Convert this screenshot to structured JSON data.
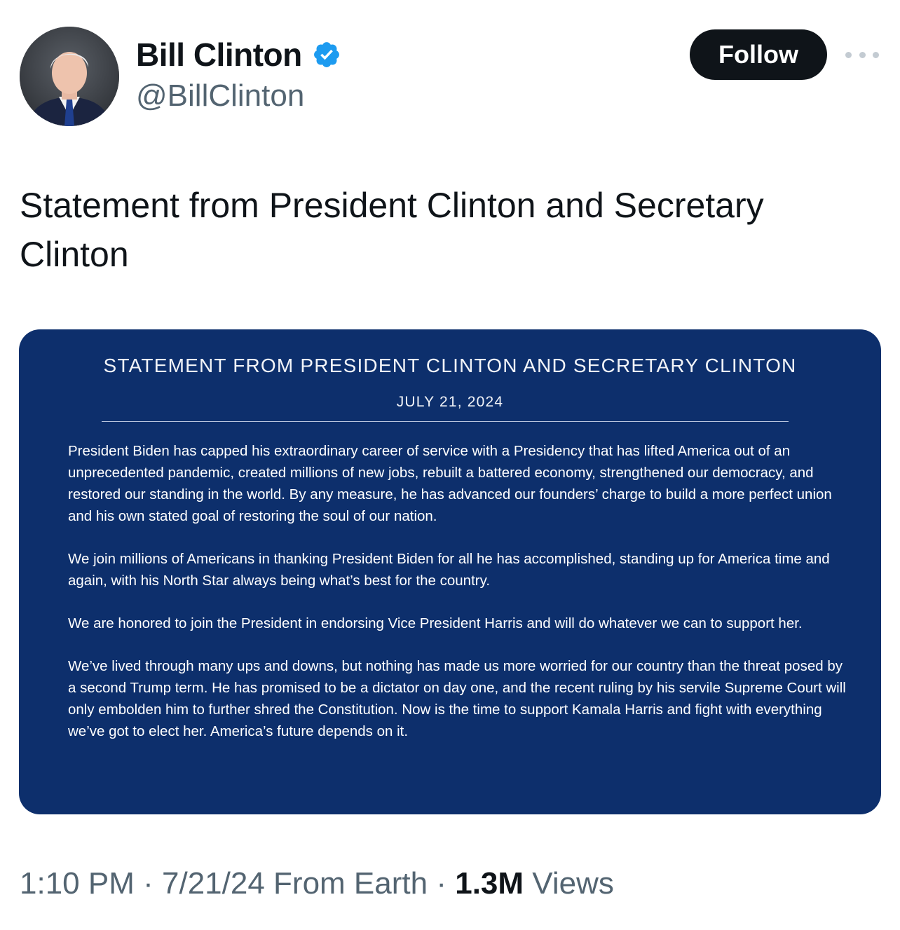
{
  "author": {
    "display_name": "Bill Clinton",
    "handle": "@BillClinton",
    "verified": true,
    "avatar_icon": "profile-photo"
  },
  "actions": {
    "follow_label": "Follow",
    "more_icon": "more-horizontal-icon"
  },
  "tweet": {
    "text": "Statement from President Clinton and Secretary Clinton"
  },
  "statement_image": {
    "background_color": "#0d2f6c",
    "title": "STATEMENT FROM PRESIDENT CLINTON AND SECRETARY CLINTON",
    "date": "JULY 21, 2024",
    "paragraphs": [
      "President Biden has capped his extraordinary career of service with a Presidency that has lifted America out of an unprecedented pandemic, created millions of new jobs, rebuilt a battered economy, strengthened our democracy, and restored our standing in the world. By any measure, he has advanced our founders’ charge to build a more perfect union and his own stated goal of restoring the soul of our nation.",
      "We join millions of Americans in thanking President Biden for all he has accomplished, standing up for America time and again, with his North Star always being what’s best for the country.",
      "We are honored to join the President in endorsing Vice President Harris and will do whatever we can to support her.",
      "We’ve lived through many ups and downs, but nothing has made us more worried for our country than the threat posed by a second Trump term. He has promised to be a dictator on day one, and the recent ruling by his servile Supreme Court will only embolden him to further shred the Constitution. Now is the time to support Kamala Harris and fight with everything we’ve got to elect her. America’s future depends on it."
    ]
  },
  "meta": {
    "time": "1:10 PM",
    "separator": "·",
    "date": "7/21/24",
    "location": "From Earth",
    "views_count": "1.3M",
    "views_label": "Views"
  },
  "colors": {
    "verified_badge": "#1d9bf0",
    "follow_button": "#0f1419",
    "secondary_text": "#536471"
  }
}
